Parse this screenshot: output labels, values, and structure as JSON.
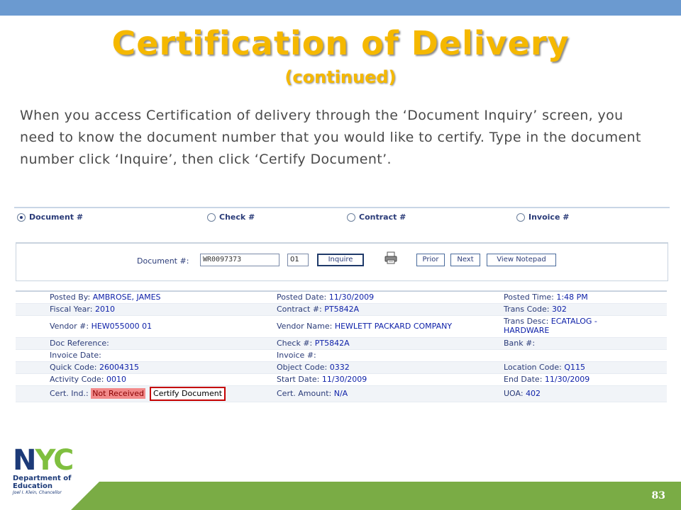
{
  "slide": {
    "title": "Certification of Delivery",
    "subtitle": "(continued)",
    "intro": "When you access Certification of delivery through the ‘Document Inquiry’ screen, you need to know the document number that you would like to certify.  Type in the document number click ‘Inquire’, then click ‘Certify Document’.",
    "page_number": "83"
  },
  "radios": [
    {
      "label": "Document #",
      "checked": true
    },
    {
      "label": "Check #",
      "checked": false
    },
    {
      "label": "Contract #",
      "checked": false
    },
    {
      "label": "Invoice #",
      "checked": false
    }
  ],
  "search": {
    "doc_label": "Document #:",
    "doc_value": "WR0097373",
    "suffix_value": "01",
    "inquire": "Inquire",
    "prior": "Prior",
    "next": "Next",
    "view_notepad": "View Notepad"
  },
  "details": {
    "posted_by": {
      "label": "Posted By:",
      "value": "AMBROSE, JAMES"
    },
    "posted_date": {
      "label": "Posted Date:",
      "value": "11/30/2009"
    },
    "posted_time": {
      "label": "Posted Time:",
      "value": "1:48 PM"
    },
    "fiscal_year": {
      "label": "Fiscal Year:",
      "value": "2010"
    },
    "contract": {
      "label": "Contract #:",
      "value": "PT5842A"
    },
    "trans_code": {
      "label": "Trans Code:",
      "value": "302"
    },
    "vendor_num": {
      "label": "Vendor #:",
      "value": "HEW055000 01"
    },
    "vendor_name": {
      "label": "Vendor Name:",
      "value": "HEWLETT PACKARD COMPANY"
    },
    "trans_desc": {
      "label": "Trans Desc:",
      "value1": "ECATALOG -",
      "value2": "HARDWARE"
    },
    "doc_ref": {
      "label": "Doc Reference:",
      "value": ""
    },
    "check": {
      "label": "Check #:",
      "value": "PT5842A"
    },
    "bank": {
      "label": "Bank #:",
      "value": ""
    },
    "invoice_date": {
      "label": "Invoice Date:",
      "value": ""
    },
    "invoice": {
      "label": "Invoice #:",
      "value": ""
    },
    "quick_code": {
      "label": "Quick Code:",
      "value": "26004315"
    },
    "object_code": {
      "label": "Object Code:",
      "value": "0332"
    },
    "location_code": {
      "label": "Location Code:",
      "value": "Q115"
    },
    "activity_code": {
      "label": "Activity Code:",
      "value": "0010"
    },
    "start_date": {
      "label": "Start Date:",
      "value": "11/30/2009"
    },
    "end_date": {
      "label": "End Date:",
      "value": "11/30/2009"
    },
    "cert_ind": {
      "label": "Cert. Ind.:",
      "value": "Not Received"
    },
    "certify_button": "Certify Document",
    "cert_amount": {
      "label": "Cert. Amount:",
      "value": "N/A"
    },
    "uoa": {
      "label": "UOA:",
      "value": "402"
    }
  },
  "logo": {
    "nyc": "NYC",
    "line1": "Department of",
    "line2": "Education",
    "line3": "Joel I. Klein, Chancellor"
  },
  "colors": {
    "top_bar": "#6b9ad0",
    "title": "#f5b800",
    "bottom_bar": "#7aac45",
    "nyc_green": "#7fbf3f",
    "nyc_blue": "#1c3a78"
  }
}
